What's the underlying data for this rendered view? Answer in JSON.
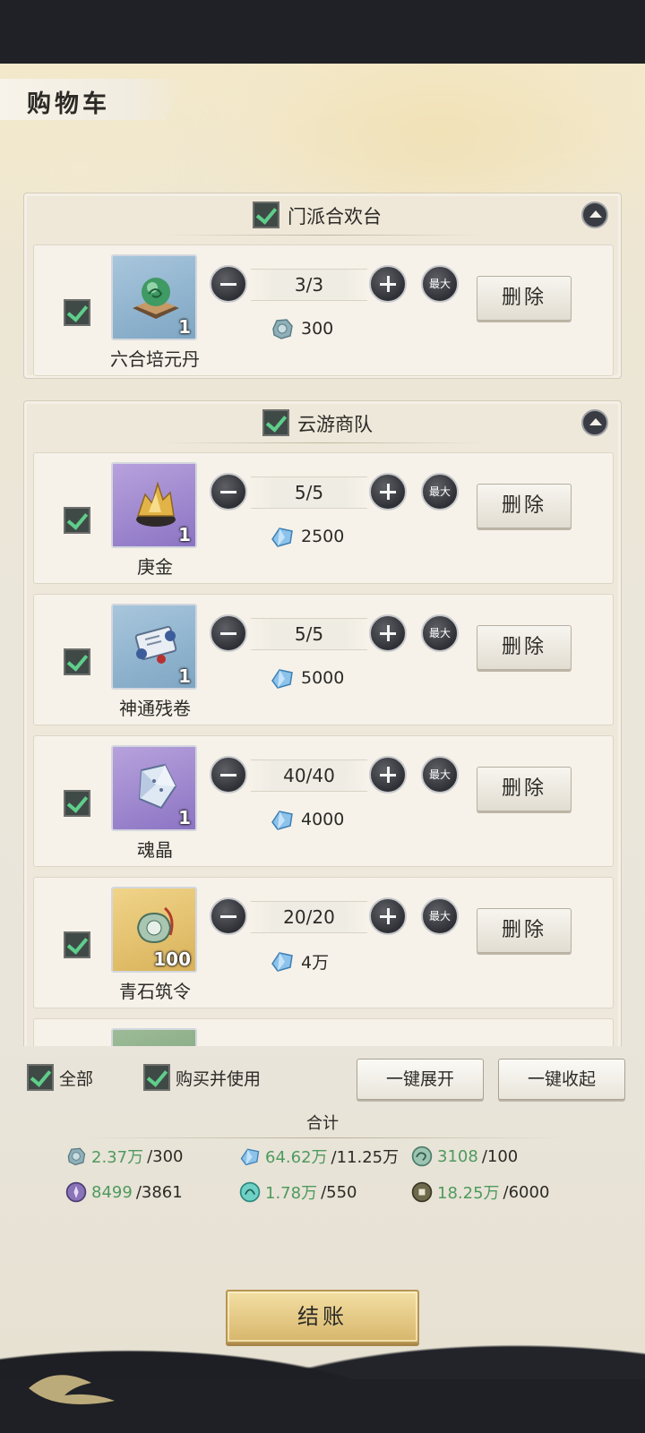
{
  "title": "购物车",
  "groups": [
    {
      "label": "门派合欢台",
      "items": [
        {
          "name": "六合培元丹",
          "badge": "1",
          "qty": "3/3",
          "price": "300",
          "icon": "green-orb-pill-icon",
          "currency_icon": "jade-token-icon",
          "max": "最大",
          "delete": "删除"
        }
      ]
    },
    {
      "label": "云游商队",
      "items": [
        {
          "name": "庚金",
          "badge": "1",
          "qty": "5/5",
          "price": "2500",
          "icon": "gold-ore-icon",
          "currency_icon": "blue-crystal-icon",
          "max": "最大",
          "delete": "删除"
        },
        {
          "name": "神通残卷",
          "badge": "1",
          "qty": "5/5",
          "price": "5000",
          "icon": "scroll-icon",
          "currency_icon": "blue-crystal-icon",
          "max": "最大",
          "delete": "删除"
        },
        {
          "name": "魂晶",
          "badge": "1",
          "qty": "40/40",
          "price": "4000",
          "icon": "soul-crystal-icon",
          "currency_icon": "blue-crystal-icon",
          "max": "最大",
          "delete": "删除"
        },
        {
          "name": "青石筑令",
          "badge": "100",
          "qty": "20/20",
          "price": "4万",
          "icon": "jade-token-bundle-icon",
          "currency_icon": "blue-crystal-icon",
          "max": "最大",
          "delete": "删除"
        }
      ]
    }
  ],
  "footer": {
    "select_all": "全部",
    "buy_and_use": "购买并使用",
    "expand_all": "一键展开",
    "collapse_all": "一键收起",
    "total_label": "合计",
    "currencies": [
      {
        "icon": "jade-token-icon",
        "have": "2.37万",
        "need": "/300"
      },
      {
        "icon": "blue-crystal-icon",
        "have": "64.62万",
        "need": "/11.25万"
      },
      {
        "icon": "jade-dragon-coin-icon",
        "have": "3108",
        "need": "/100"
      },
      {
        "icon": "purple-emblem-icon",
        "have": "8499",
        "need": "/3861"
      },
      {
        "icon": "cyan-beast-coin-icon",
        "have": "1.78万",
        "need": "/550"
      },
      {
        "icon": "copper-coin-icon",
        "have": "18.25万",
        "need": "/6000"
      }
    ],
    "checkout": "结账"
  },
  "colors": {
    "have_amount": "#4f9a5e",
    "check": "#5fce8a"
  }
}
